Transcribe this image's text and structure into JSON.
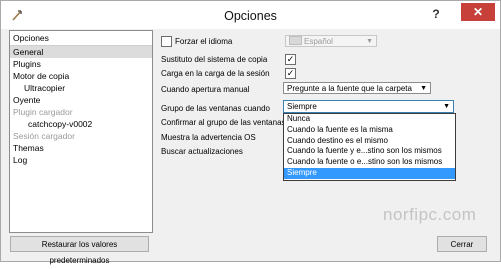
{
  "window": {
    "title": "Opciones",
    "help_label": "?",
    "close_label": "✕"
  },
  "sidebar": {
    "header": "Opciones",
    "items": [
      {
        "label": "General",
        "state": "selected"
      },
      {
        "label": "Plugins",
        "state": "normal"
      },
      {
        "label": "Motor de copia",
        "state": "normal"
      },
      {
        "label": "Ultracopier",
        "state": "normal"
      },
      {
        "label": "Oyente",
        "state": "normal"
      },
      {
        "label": "Plugin cargador",
        "state": "disabled"
      },
      {
        "label": "catchcopy-v0002",
        "state": "normal"
      },
      {
        "label": "Sesión cargador",
        "state": "disabled"
      },
      {
        "label": "Themas",
        "state": "normal"
      },
      {
        "label": "Log",
        "state": "normal"
      }
    ]
  },
  "general": {
    "force_language": {
      "label": "Forzar el idioma",
      "checked": false
    },
    "language_combo": {
      "value": "Español",
      "disabled": true
    },
    "replace_copy_system": {
      "label": "Sustituto del sistema de copia",
      "checked": true
    },
    "load_on_session": {
      "label": "Carga en la carga de la sesión",
      "checked": true
    },
    "manual_open": {
      "label": "Cuando apertura manual",
      "value": "Pregunte a la fuente que la carpeta"
    },
    "window_group": {
      "label": "Grupo de las ventanas cuando",
      "value": "Siempre",
      "options": [
        "Nunca",
        "Cuando la fuente es la misma",
        "Cuando destino es el mismo",
        "Cuando la fuente y e...stino son los mismos",
        "Cuando la fuente o e...stino son los mismos",
        "Siempre"
      ],
      "selected_index": 5
    },
    "confirm_group": {
      "label": "Confirmar al grupo de las ventanas"
    },
    "show_warning": {
      "label": "Muestra la advertencia OS"
    },
    "check_updates": {
      "label": "Buscar actualizaciones"
    }
  },
  "watermark": "norfipc.com",
  "footer": {
    "restore_label": "Restaurar los valores predeterminados",
    "close_label": "Cerrar"
  },
  "colors": {
    "selection": "#3399ff",
    "close_button": "#c7413a"
  }
}
